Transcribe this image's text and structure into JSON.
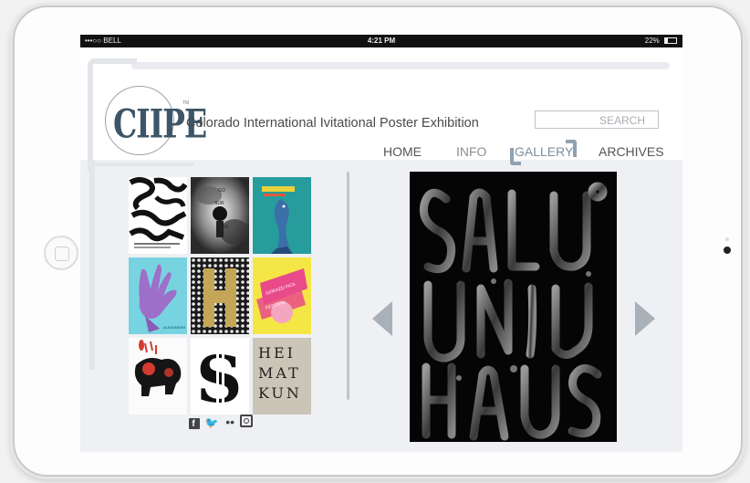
{
  "status_bar": {
    "carrier": "•••○○ BELL ",
    "time": "4:21 PM",
    "battery": "22%"
  },
  "header": {
    "logo_text": "CIIPE",
    "site_title": "Colorado International Ivitational Poster Exhibition",
    "search_placeholder": "SEARCH"
  },
  "nav": {
    "items": [
      {
        "label": "HOME"
      },
      {
        "label": "INFO"
      },
      {
        "label": "GALLERY",
        "active": true
      },
      {
        "label": "ARCHIVES"
      }
    ]
  },
  "gallery": {
    "thumbnails": [
      {
        "name": "poster-type-black"
      },
      {
        "name": "poster-smoke-portrait"
      },
      {
        "name": "poster-blue-fish"
      },
      {
        "name": "poster-purple-glove"
      },
      {
        "name": "poster-gold-h"
      },
      {
        "name": "poster-yellow-pink"
      },
      {
        "name": "poster-red-bear"
      },
      {
        "name": "poster-black-s"
      },
      {
        "name": "poster-heimatkunde"
      }
    ],
    "heimatkunde_letters": "HEI MAT KUN"
  },
  "social": {
    "icons": [
      "facebook-icon",
      "twitter-icon",
      "flickr-icon",
      "instagram-icon"
    ]
  },
  "viewer": {
    "poster_text": "SALUD UN HAUS"
  },
  "colors": {
    "accent": "#8fa2b2",
    "screen_bg": "#eef0f4",
    "arrow": "#aab0b7"
  }
}
